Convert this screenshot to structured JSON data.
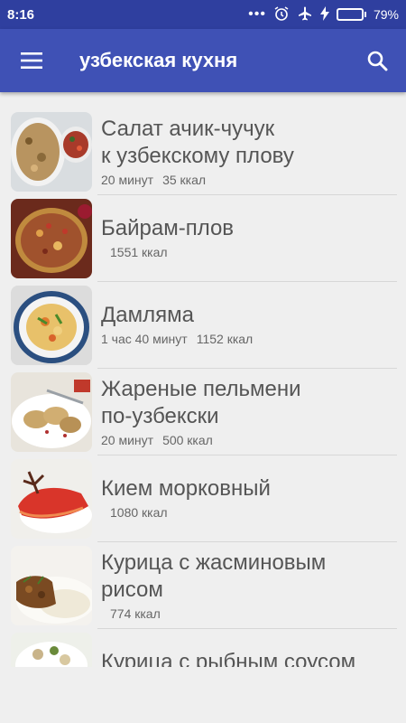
{
  "status_bar": {
    "time": "8:16",
    "dots": "•••",
    "battery_percent": "79%",
    "battery_level": 0.79,
    "battery_color": "#4cd964"
  },
  "app_bar": {
    "title": "узбекская кухня",
    "menu_icon": "hamburger-menu-icon",
    "search_icon": "search-icon",
    "color": "#3f51b5"
  },
  "recipes": [
    {
      "title_line1": "Салат ачик-чучук",
      "title_line2": "к узбекскому плову",
      "time": "20 минут",
      "kcal": "35 ккал"
    },
    {
      "title_line1": "Байрам-плов",
      "title_line2": "",
      "time": "",
      "kcal": "1551 ккал"
    },
    {
      "title_line1": "Дамляма",
      "title_line2": "",
      "time": "1 час 40 минут",
      "kcal": "1152 ккал"
    },
    {
      "title_line1": "Жареные пельмени",
      "title_line2": "по-узбекски",
      "time": "20 минут",
      "kcal": "500 ккал"
    },
    {
      "title_line1": "Кием морковный",
      "title_line2": "",
      "time": "",
      "kcal": "1080 ккал"
    },
    {
      "title_line1": "Курица с жасминовым",
      "title_line2": "рисом",
      "time": "",
      "kcal": "774 ккал"
    },
    {
      "title_line1": "Курица с рыбным соусом",
      "title_line2": "",
      "time": "",
      "kcal": ""
    }
  ]
}
